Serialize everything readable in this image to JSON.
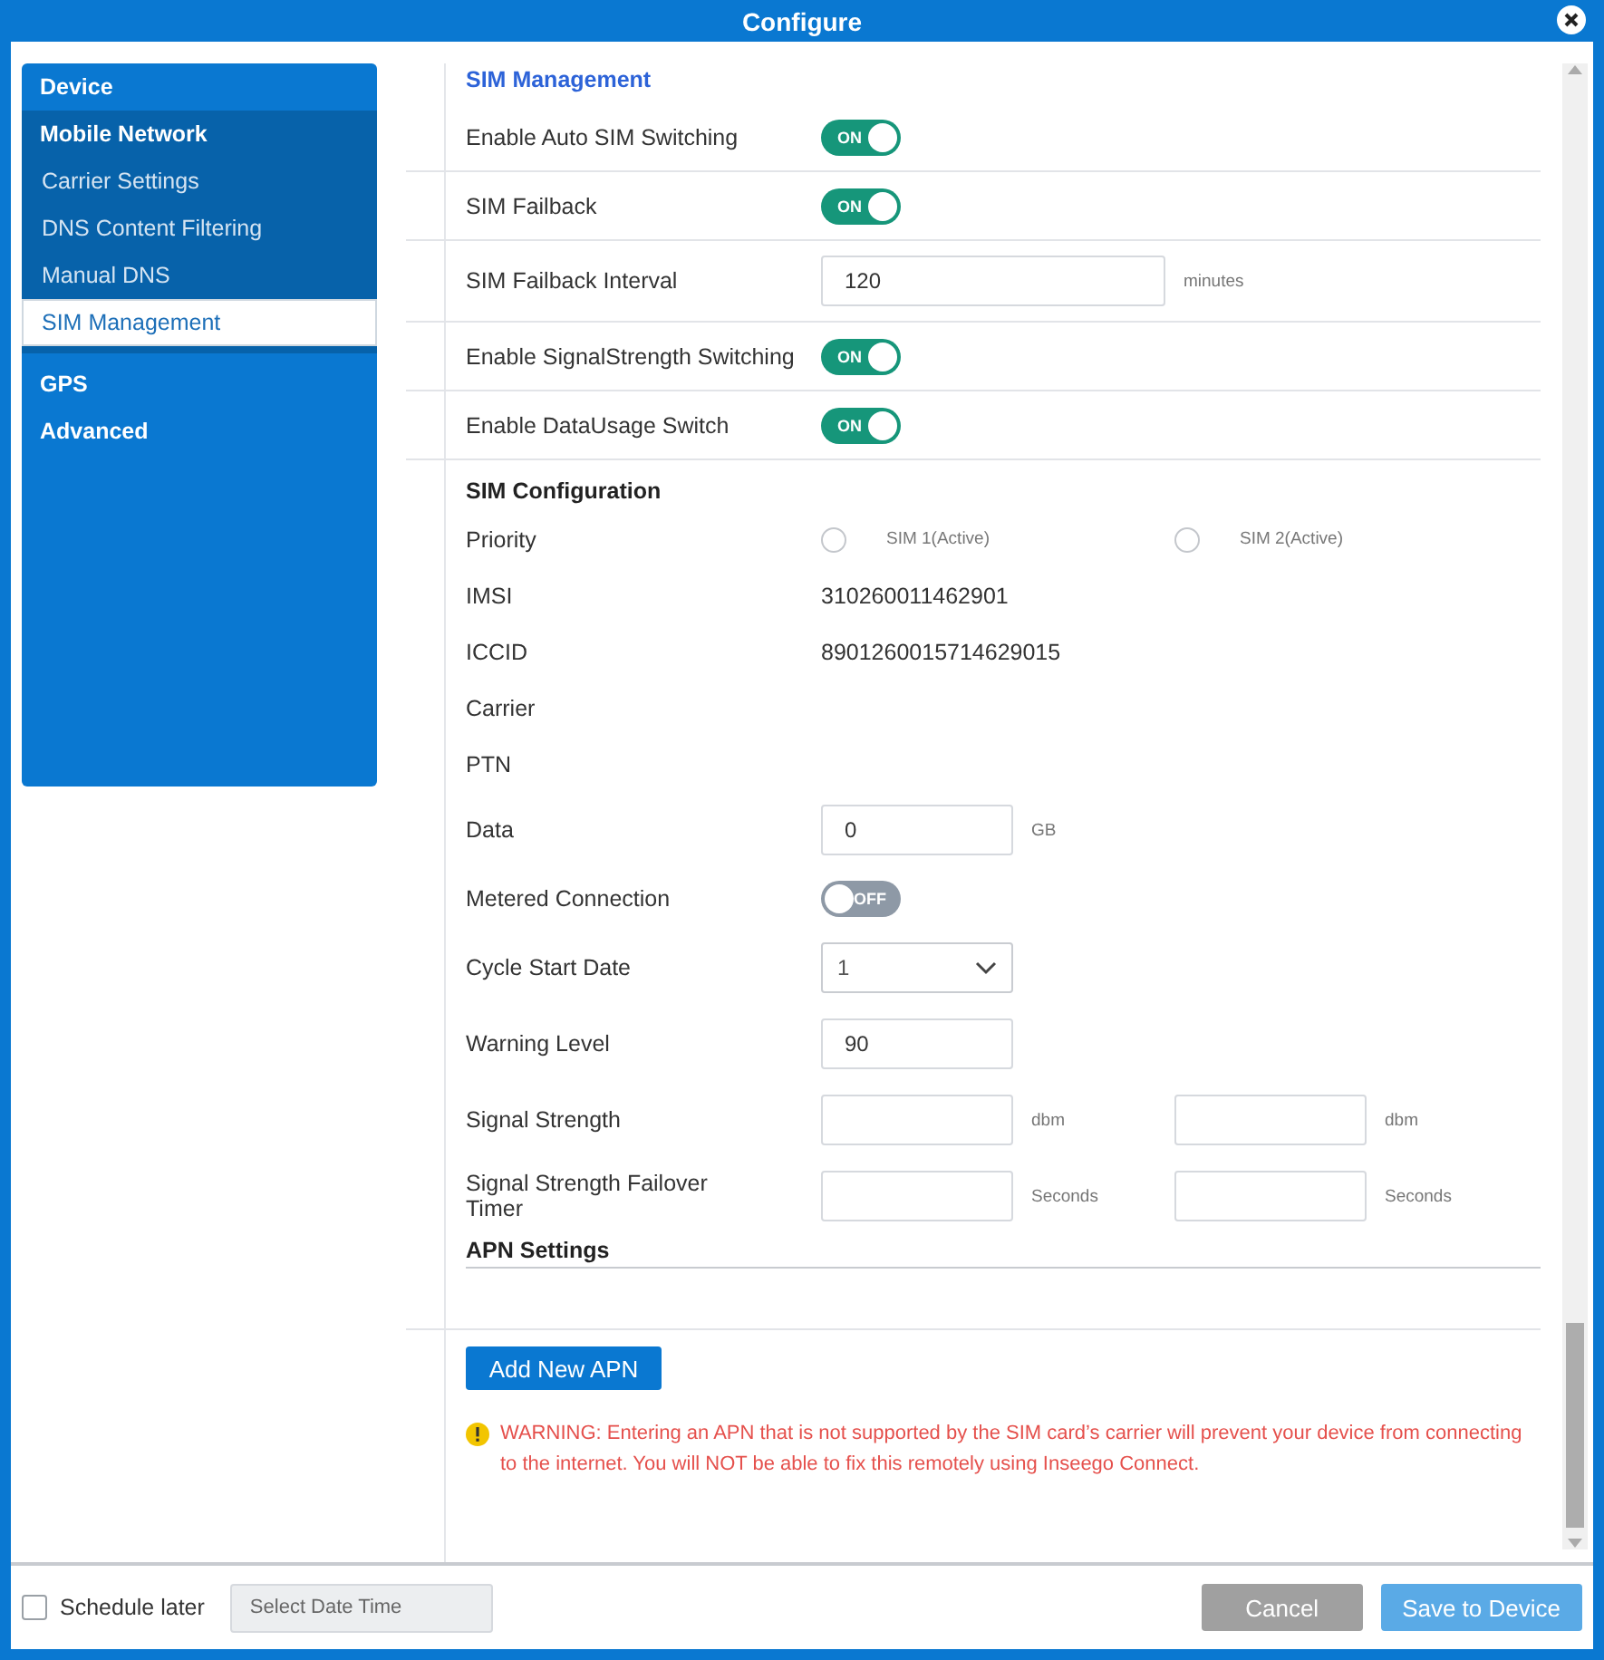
{
  "window": {
    "title": "Configure"
  },
  "sidebar": {
    "sections": [
      {
        "label": "Device",
        "selected": false,
        "expanded": false
      },
      {
        "label": "Mobile Network",
        "selected": false,
        "expanded": true,
        "children": [
          {
            "label": "Carrier Settings",
            "selected": false
          },
          {
            "label": "DNS Content Filtering",
            "selected": false
          },
          {
            "label": "Manual DNS",
            "selected": false
          },
          {
            "label": "SIM Management",
            "selected": true
          }
        ]
      },
      {
        "label": "GPS",
        "selected": false,
        "expanded": false
      },
      {
        "label": "Advanced",
        "selected": false,
        "expanded": false
      }
    ]
  },
  "sim_management": {
    "title": "SIM Management",
    "settings": [
      {
        "label": "Enable Auto SIM Switching",
        "kind": "toggle",
        "on": true,
        "toggle_text": "ON"
      },
      {
        "label": "SIM Failback",
        "kind": "toggle",
        "on": true,
        "toggle_text": "ON"
      },
      {
        "label": "SIM Failback Interval",
        "kind": "input",
        "value": "120",
        "unit": "minutes"
      },
      {
        "label": "Enable SignalStrength Switching",
        "kind": "toggle",
        "on": true,
        "toggle_text": "ON"
      },
      {
        "label": "Enable DataUsage Switch",
        "kind": "toggle",
        "on": true,
        "toggle_text": "ON"
      }
    ]
  },
  "sim_configuration": {
    "title": "SIM Configuration",
    "rows": [
      {
        "label": "Priority",
        "kind": "radio",
        "options": [
          {
            "label": "SIM 1(Active)",
            "selected": false
          },
          {
            "label": "SIM 2(Active)",
            "selected": false
          }
        ]
      },
      {
        "label": "IMSI",
        "kind": "text",
        "value": "310260011462901"
      },
      {
        "label": "ICCID",
        "kind": "text",
        "value": "8901260015714629015"
      },
      {
        "label": "Carrier",
        "kind": "text"
      },
      {
        "label": "PTN",
        "kind": "text"
      },
      {
        "label": "Data",
        "kind": "inputs",
        "fields": [
          {
            "value": "0",
            "unit": "GB"
          }
        ]
      },
      {
        "label": "Metered Connection",
        "kind": "toggle",
        "on": false,
        "toggle_text": "OFF"
      },
      {
        "label": "Cycle Start Date",
        "kind": "select",
        "value": "1"
      },
      {
        "label": "Warning Level",
        "kind": "inputs",
        "fields": [
          {
            "value": "90"
          }
        ]
      },
      {
        "label": "Signal Strength",
        "kind": "inputs",
        "fields": [
          {
            "unit": "dbm"
          },
          {
            "unit": "dbm"
          }
        ]
      },
      {
        "label": "Signal Strength Failover Timer",
        "kind": "inputs",
        "fields": [
          {
            "unit": "Seconds"
          },
          {
            "unit": "Seconds"
          }
        ]
      }
    ]
  },
  "apn": {
    "title": "APN Settings",
    "add_button": "Add New APN",
    "warning": "WARNING: Entering an APN that is not supported by the SIM card’s carrier will prevent your device from connecting to the internet. You will NOT be able to fix this remotely using Inseego Connect."
  },
  "footer": {
    "schedule_later": {
      "label": "Schedule later",
      "checked": false
    },
    "date_field": {
      "placeholder": "Select Date Time"
    },
    "buttons": [
      {
        "label": "Cancel",
        "kind": "secondary"
      },
      {
        "label": "Save to Device",
        "kind": "primary"
      }
    ]
  }
}
